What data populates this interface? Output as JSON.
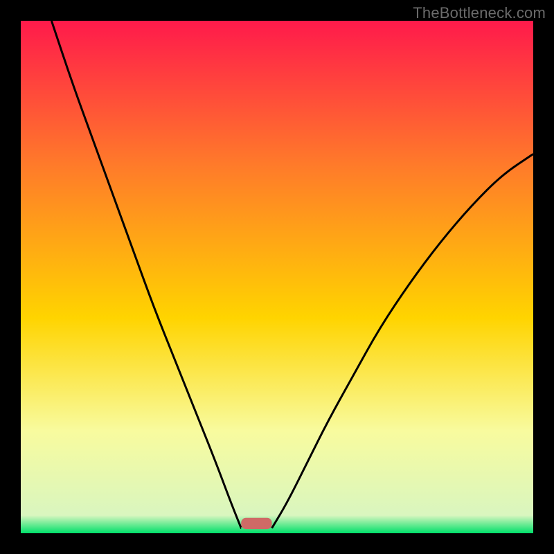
{
  "watermark": "TheBottleneck.com",
  "colors": {
    "top": "#ff1a4b",
    "mid1": "#ff7a2a",
    "mid2": "#ffd400",
    "mid3": "#f8fb9e",
    "bottom": "#00e06a",
    "curve": "#000000",
    "marker": "#cf6a66",
    "frame": "#000000"
  },
  "chart_data": {
    "type": "line",
    "title": "",
    "xlabel": "",
    "ylabel": "",
    "xlim": [
      0,
      100
    ],
    "ylim": [
      0,
      100
    ],
    "grid": false,
    "legend": false,
    "series": [
      {
        "name": "left-branch",
        "x": [
          6,
          10,
          14,
          18,
          22,
          26,
          30,
          34,
          38,
          41,
          43
        ],
        "y": [
          100,
          88,
          77,
          66,
          55,
          44,
          34,
          24,
          14,
          6,
          1
        ]
      },
      {
        "name": "right-branch",
        "x": [
          49,
          52,
          56,
          60,
          65,
          70,
          76,
          82,
          88,
          94,
          100
        ],
        "y": [
          1,
          6,
          14,
          22,
          31,
          40,
          49,
          57,
          64,
          70,
          74
        ]
      }
    ],
    "marker": {
      "name": "optimum-region",
      "x_range": [
        43,
        49
      ],
      "y": 0.8,
      "height": 2.2
    },
    "gradient_stops": [
      {
        "offset": 0.0,
        "color": "#ff1a4b"
      },
      {
        "offset": 0.28,
        "color": "#ff7a2a"
      },
      {
        "offset": 0.58,
        "color": "#ffd400"
      },
      {
        "offset": 0.8,
        "color": "#f8fb9e"
      },
      {
        "offset": 0.965,
        "color": "#d9f6bf"
      },
      {
        "offset": 1.0,
        "color": "#00e06a"
      }
    ]
  }
}
